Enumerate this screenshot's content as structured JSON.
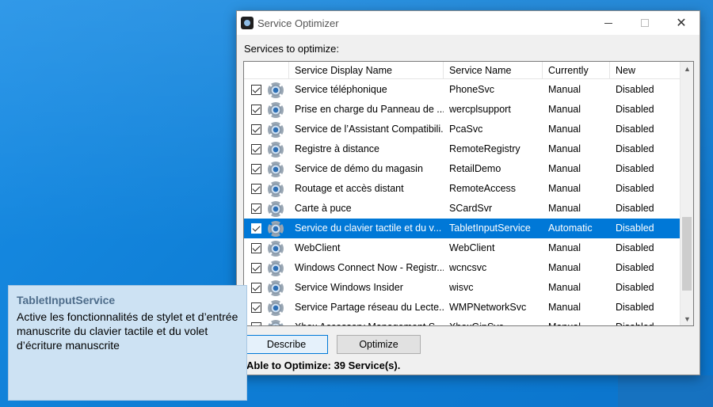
{
  "window": {
    "title": "Service Optimizer",
    "minimize_icon": "minimize-icon",
    "maximize_icon": "maximize-icon",
    "close_icon": "close-icon",
    "close_glyph": "✕"
  },
  "list_label": "Services to optimize:",
  "columns": [
    "",
    "Service Display Name",
    "Service Name",
    "Currently",
    "New"
  ],
  "rows": [
    {
      "checked": true,
      "display": "Service téléphonique",
      "name": "PhoneSvc",
      "current": "Manual",
      "new": "Disabled"
    },
    {
      "checked": true,
      "display": "Prise en charge du Panneau de ...",
      "name": "wercplsupport",
      "current": "Manual",
      "new": "Disabled"
    },
    {
      "checked": true,
      "display": "Service de l’Assistant Compatibili...",
      "name": "PcaSvc",
      "current": "Manual",
      "new": "Disabled"
    },
    {
      "checked": true,
      "display": "Registre à distance",
      "name": "RemoteRegistry",
      "current": "Manual",
      "new": "Disabled"
    },
    {
      "checked": true,
      "display": "Service de démo du magasin",
      "name": "RetailDemo",
      "current": "Manual",
      "new": "Disabled"
    },
    {
      "checked": true,
      "display": "Routage et accès distant",
      "name": "RemoteAccess",
      "current": "Manual",
      "new": "Disabled"
    },
    {
      "checked": true,
      "display": "Carte à puce",
      "name": "SCardSvr",
      "current": "Manual",
      "new": "Disabled"
    },
    {
      "checked": true,
      "display": "Service du clavier tactile et du v...",
      "name": "TabletInputService",
      "current": "Automatic",
      "new": "Disabled",
      "selected": true
    },
    {
      "checked": true,
      "display": "WebClient",
      "name": "WebClient",
      "current": "Manual",
      "new": "Disabled"
    },
    {
      "checked": true,
      "display": "Windows Connect Now - Registr...",
      "name": "wcncsvc",
      "current": "Manual",
      "new": "Disabled"
    },
    {
      "checked": true,
      "display": "Service Windows Insider",
      "name": "wisvc",
      "current": "Manual",
      "new": "Disabled"
    },
    {
      "checked": true,
      "display": "Service Partage réseau du Lecte...",
      "name": "WMPNetworkSvc",
      "current": "Manual",
      "new": "Disabled"
    },
    {
      "checked": true,
      "display": "Xbox Accessory Management S...",
      "name": "XboxGipSvc",
      "current": "Manual",
      "new": "Disabled"
    }
  ],
  "buttons": {
    "describe": "Describe",
    "optimize": "Optimize"
  },
  "status": "Able to Optimize: 39 Service(s).",
  "tooltip": {
    "title": "TabletInputService",
    "body": "Active les fonctionnalités de stylet et d’entrée manuscrite du clavier tactile et du volet d’écriture manuscrite"
  },
  "scrollbar": {
    "up_glyph": "▲",
    "down_glyph": "▼"
  },
  "colors": {
    "selection": "#0078d7",
    "tooltip_bg": "#cde2f3",
    "desktop": "#0f7fd6"
  }
}
